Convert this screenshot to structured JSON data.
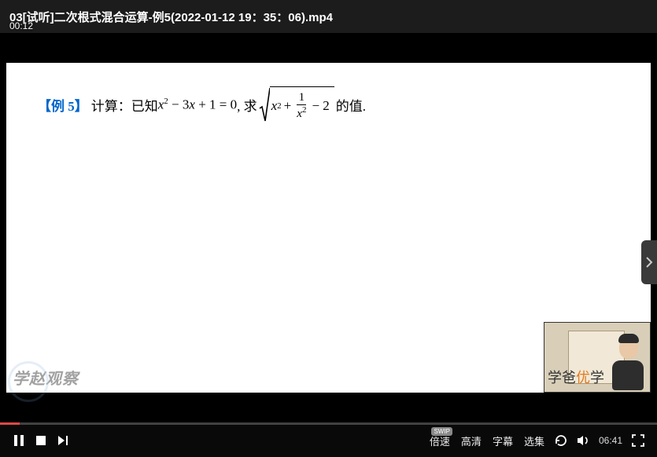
{
  "title": "03[试听]二次根式混合运算-例5(2022-01-12 19：35：06).mp4",
  "problem": {
    "tag": "【例 5】",
    "lead": "计算：已知 ",
    "equation_lhs": "x² − 3x + 1 = 0",
    "mid": ", 求",
    "radicand_prefix": "x² +",
    "frac_num": "1",
    "frac_den": "x²",
    "radicand_suffix": "− 2",
    "tail": " 的值."
  },
  "watermark_left": "学赵观察",
  "pip_watermark_a": "学爸",
  "pip_watermark_b": "优",
  "pip_watermark_c": "学",
  "controls": {
    "current_time": "00:12",
    "duration": "06:41",
    "rate_label": "倍速",
    "rate_badge": "SWIP",
    "quality_label": "高清",
    "subtitle_label": "字幕",
    "playlist_label": "选集",
    "progress_pct": 3
  }
}
